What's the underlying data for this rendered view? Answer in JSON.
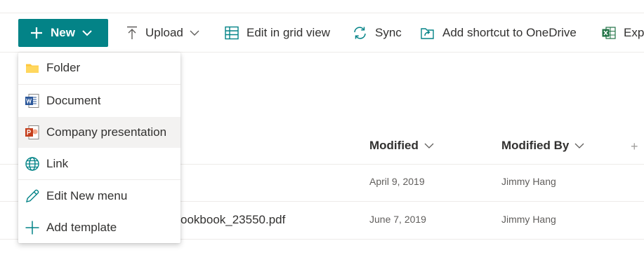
{
  "commandbar": {
    "new_label": "New",
    "upload_label": "Upload",
    "edit_grid_label": "Edit in grid view",
    "sync_label": "Sync",
    "add_shortcut_label": "Add shortcut to OneDrive",
    "export_label": "Expo"
  },
  "new_menu": {
    "items": [
      {
        "label": "Folder",
        "icon": "folder-icon"
      },
      {
        "label": "Document",
        "icon": "word-document-icon"
      },
      {
        "label": "Company presentation",
        "icon": "powerpoint-icon"
      },
      {
        "label": "Link",
        "icon": "globe-icon"
      },
      {
        "label": "Edit New menu",
        "icon": "pencil-icon"
      },
      {
        "label": "Add template",
        "icon": "plus-icon"
      }
    ],
    "hovered": "Company presentation"
  },
  "list": {
    "columns": {
      "modified": "Modified",
      "modified_by": "Modified By",
      "add_column": "+"
    },
    "rows": [
      {
        "name": "",
        "modified": "April 9, 2019",
        "modified_by": "Jimmy Hang"
      },
      {
        "name": "ookbook_23550.pdf",
        "modified": "June 7, 2019",
        "modified_by": "Jimmy Hang"
      }
    ]
  },
  "colors": {
    "accent": "#038387",
    "word": "#2b579a",
    "powerpoint": "#c43e1c",
    "folder": "#ffc83d",
    "excel": "#217346"
  }
}
